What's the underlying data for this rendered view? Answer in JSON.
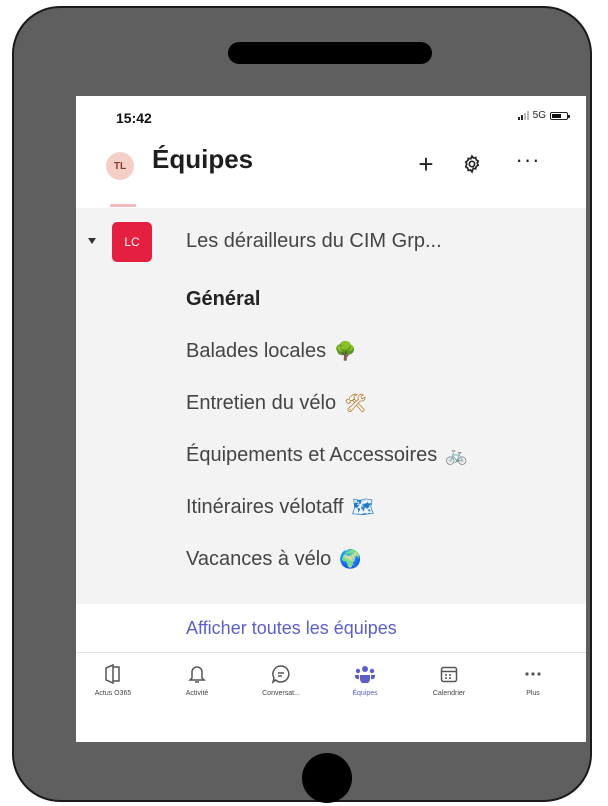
{
  "status_bar": {
    "time": "15:42",
    "network": "5G"
  },
  "header": {
    "avatar_initials": "TL",
    "title": "Équipes",
    "add_label": "+",
    "more_label": "···"
  },
  "team": {
    "initials": "LC",
    "name": "Les dérailleurs du CIM Grp...",
    "channels": [
      {
        "label": "Général",
        "emoji": ""
      },
      {
        "label": "Balades locales",
        "emoji": "🌳"
      },
      {
        "label": "Entretien du vélo",
        "emoji": "🛠"
      },
      {
        "label": "Équipements et Accessoires",
        "emoji": "🚲"
      },
      {
        "label": "Itinéraires vélotaff",
        "emoji": "🗺"
      },
      {
        "label": "Vacances à vélo",
        "emoji": "🌍"
      }
    ]
  },
  "show_all_label": "Afficher toutes les équipes",
  "tabs": [
    {
      "label": "Actus O365",
      "icon": "news-icon"
    },
    {
      "label": "Activité",
      "icon": "bell-icon"
    },
    {
      "label": "Conversat...",
      "icon": "chat-icon"
    },
    {
      "label": "Équipes",
      "icon": "teams-icon",
      "active": true
    },
    {
      "label": "Calendrier",
      "icon": "calendar-icon"
    },
    {
      "label": "Plus",
      "icon": "more-icon"
    }
  ],
  "colors": {
    "accent": "#5b5fc7",
    "team_logo": "#e51f3f",
    "phone_frame": "#5f5f5f",
    "panel_bg": "#f3f3f3"
  }
}
